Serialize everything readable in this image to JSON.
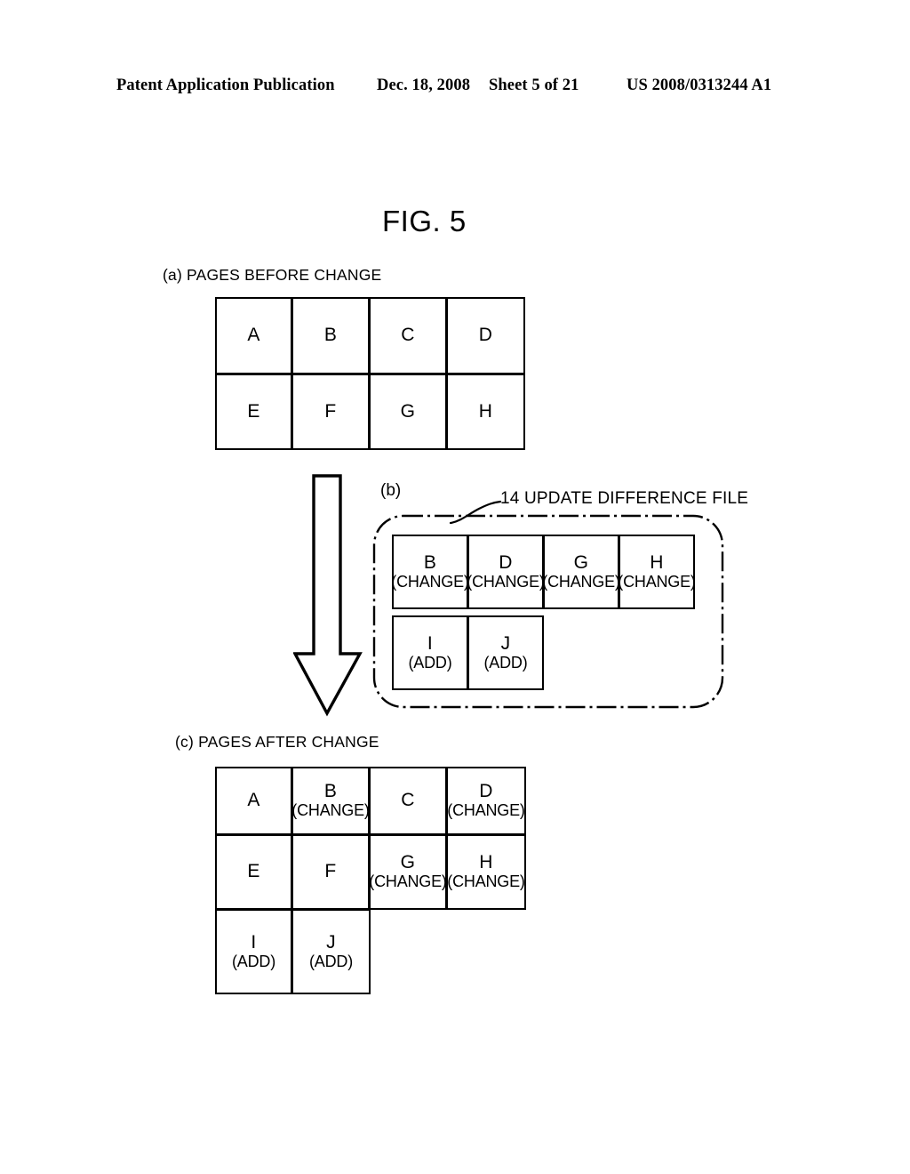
{
  "header": {
    "publication": "Patent Application Publication",
    "date": "Dec. 18, 2008",
    "sheet": "Sheet 5 of 21",
    "patent_number": "US 2008/0313244 A1"
  },
  "figure": {
    "title": "FIG. 5"
  },
  "sections": {
    "a": {
      "label": "(a) PAGES BEFORE CHANGE",
      "rows": [
        [
          {
            "main": "A",
            "sub": ""
          },
          {
            "main": "B",
            "sub": ""
          },
          {
            "main": "C",
            "sub": ""
          },
          {
            "main": "D",
            "sub": ""
          }
        ],
        [
          {
            "main": "E",
            "sub": ""
          },
          {
            "main": "F",
            "sub": ""
          },
          {
            "main": "G",
            "sub": ""
          },
          {
            "main": "H",
            "sub": ""
          }
        ]
      ]
    },
    "b": {
      "label": "(b)",
      "callout_number": "14",
      "callout_text": "UPDATE DIFFERENCE FILE",
      "callout_full": "14 UPDATE DIFFERENCE FILE",
      "rows": [
        [
          {
            "main": "B",
            "sub": "(CHANGE)"
          },
          {
            "main": "D",
            "sub": "(CHANGE)"
          },
          {
            "main": "G",
            "sub": "(CHANGE)"
          },
          {
            "main": "H",
            "sub": "(CHANGE)"
          }
        ],
        [
          {
            "main": "I",
            "sub": "(ADD)"
          },
          {
            "main": "J",
            "sub": "(ADD)"
          }
        ]
      ]
    },
    "c": {
      "label": "(c) PAGES AFTER CHANGE",
      "rows": [
        [
          {
            "main": "A",
            "sub": ""
          },
          {
            "main": "B",
            "sub": "(CHANGE)"
          },
          {
            "main": "C",
            "sub": ""
          },
          {
            "main": "D",
            "sub": "(CHANGE)"
          }
        ],
        [
          {
            "main": "E",
            "sub": ""
          },
          {
            "main": "F",
            "sub": ""
          },
          {
            "main": "G",
            "sub": "(CHANGE)"
          },
          {
            "main": "H",
            "sub": "(CHANGE)"
          }
        ],
        [
          {
            "main": "I",
            "sub": "(ADD)"
          },
          {
            "main": "J",
            "sub": "(ADD)"
          }
        ]
      ]
    }
  },
  "colors": {
    "ink": "#000000",
    "paper": "#ffffff"
  }
}
